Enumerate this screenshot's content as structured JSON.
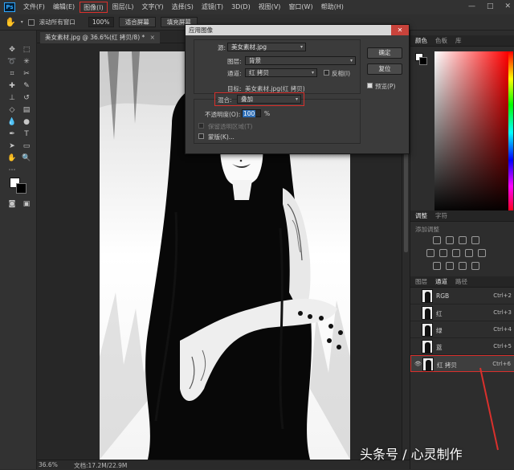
{
  "app": {
    "logo": "Ps"
  },
  "menubar": {
    "items": [
      "文件(F)",
      "编辑(E)",
      "图像(I)",
      "图层(L)",
      "文字(Y)",
      "选择(S)",
      "滤镜(T)",
      "3D(D)",
      "视图(V)",
      "窗口(W)",
      "帮助(H)"
    ],
    "active_index": 2,
    "window_controls": [
      "—",
      "□",
      "✕"
    ]
  },
  "optbar": {
    "scroll_all_label": "滚动所有窗口",
    "zoom_value": "100%",
    "fit_screen": "适合屏幕",
    "fill_screen": "填充屏幕"
  },
  "doc_tab": {
    "label": "美女素材.jpg @ 36.6%(红 拷贝/8) *",
    "close": "×"
  },
  "status": {
    "zoom": "36.6%",
    "doc_info": "文档:17.2M/22.9M"
  },
  "panels": {
    "color_tabs": [
      "颜色",
      "色板",
      "库"
    ],
    "adjust_tabs": [
      "调整",
      "字符"
    ],
    "adjust_hint": "添加调整",
    "channel_tabs": [
      "图层",
      "通道",
      "路径"
    ]
  },
  "channels": [
    {
      "name": "RGB",
      "key": "Ctrl+2",
      "selected": false
    },
    {
      "name": "红",
      "key": "Ctrl+3",
      "selected": false
    },
    {
      "name": "绿",
      "key": "Ctrl+4",
      "selected": false
    },
    {
      "name": "蓝",
      "key": "Ctrl+5",
      "selected": false
    },
    {
      "name": "红 拷贝",
      "key": "Ctrl+6",
      "selected": true
    }
  ],
  "dialog": {
    "title": "应用图像",
    "close": "✕",
    "source_label": "源:",
    "source_value": "美女素材.jpg",
    "layer_label": "图层:",
    "layer_value": "背景",
    "channel_label": "通道:",
    "channel_value": "红 拷贝",
    "invert_label": "反相(I)",
    "target_label": "目标:",
    "target_value": "美女素材.jpg(红 拷贝)",
    "blend_label": "混合:",
    "blend_value": "叠加",
    "opacity_label": "不透明度(O):",
    "opacity_value": "100",
    "opacity_unit": "%",
    "preserve_label": "保留透明区域(T)",
    "mask_label": "蒙版(K)...",
    "ok": "确定",
    "reset": "复位",
    "preview_label": "预览(P)"
  },
  "watermark": "头条号 / 心灵制作",
  "colors": {
    "accent_red": "#d9302c",
    "ps_blue": "#31a8ff"
  }
}
